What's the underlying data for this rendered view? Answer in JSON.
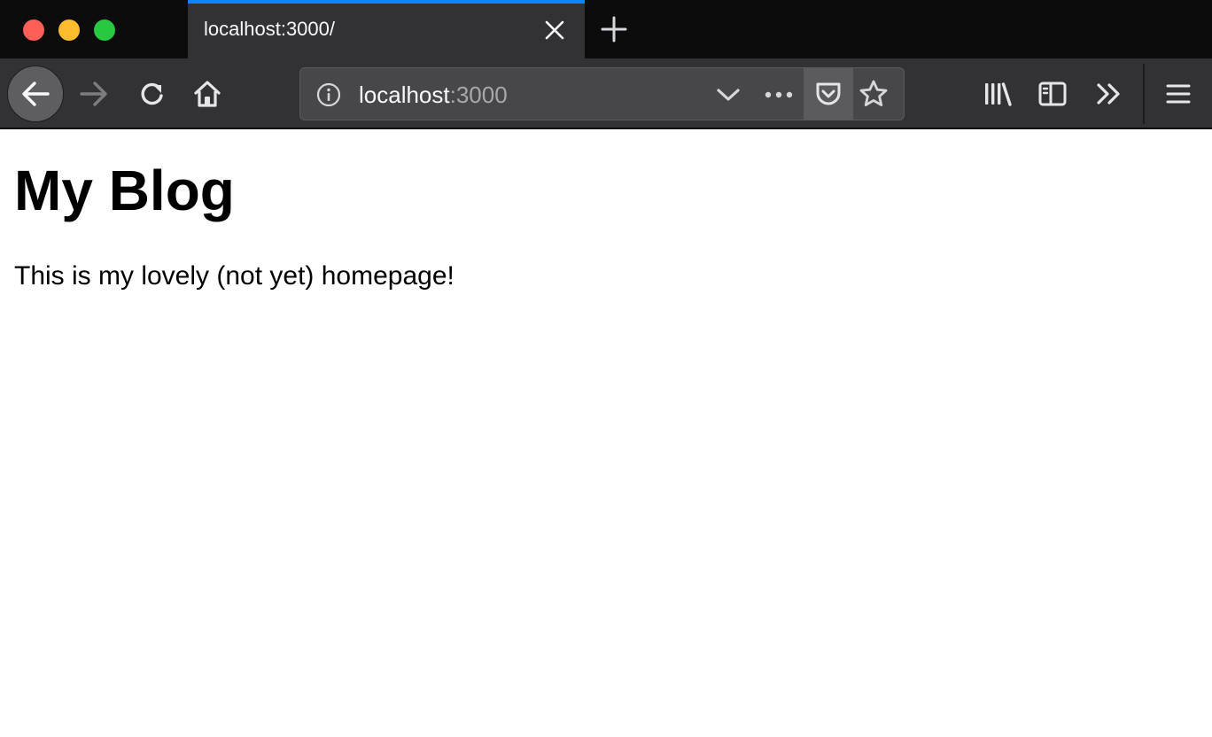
{
  "colors": {
    "tab_accent": "#0a84ff",
    "traffic_close": "#fe5f57",
    "traffic_minimize": "#febc2e",
    "traffic_maximize": "#28c840"
  },
  "window": {
    "controls": [
      "close-window-icon",
      "minimize-window-icon",
      "maximize-window-icon"
    ]
  },
  "tab": {
    "title": "localhost:3000/",
    "close_icon": "close-icon",
    "new_tab_icon": "plus-icon"
  },
  "toolbar": {
    "icons": [
      "back-arrow-icon",
      "forward-arrow-icon",
      "reload-icon",
      "home-icon",
      "library-icon",
      "sidebar-icon",
      "chevrons-right-icon",
      "hamburger-menu-icon"
    ]
  },
  "urlbar": {
    "host": "localhost",
    "port": ":3000",
    "icons": [
      "info-icon",
      "chevron-down-icon",
      "more-dots-icon",
      "pocket-icon",
      "star-icon"
    ]
  },
  "page": {
    "heading": "My Blog",
    "paragraph": "This is my lovely (not yet) homepage!"
  }
}
